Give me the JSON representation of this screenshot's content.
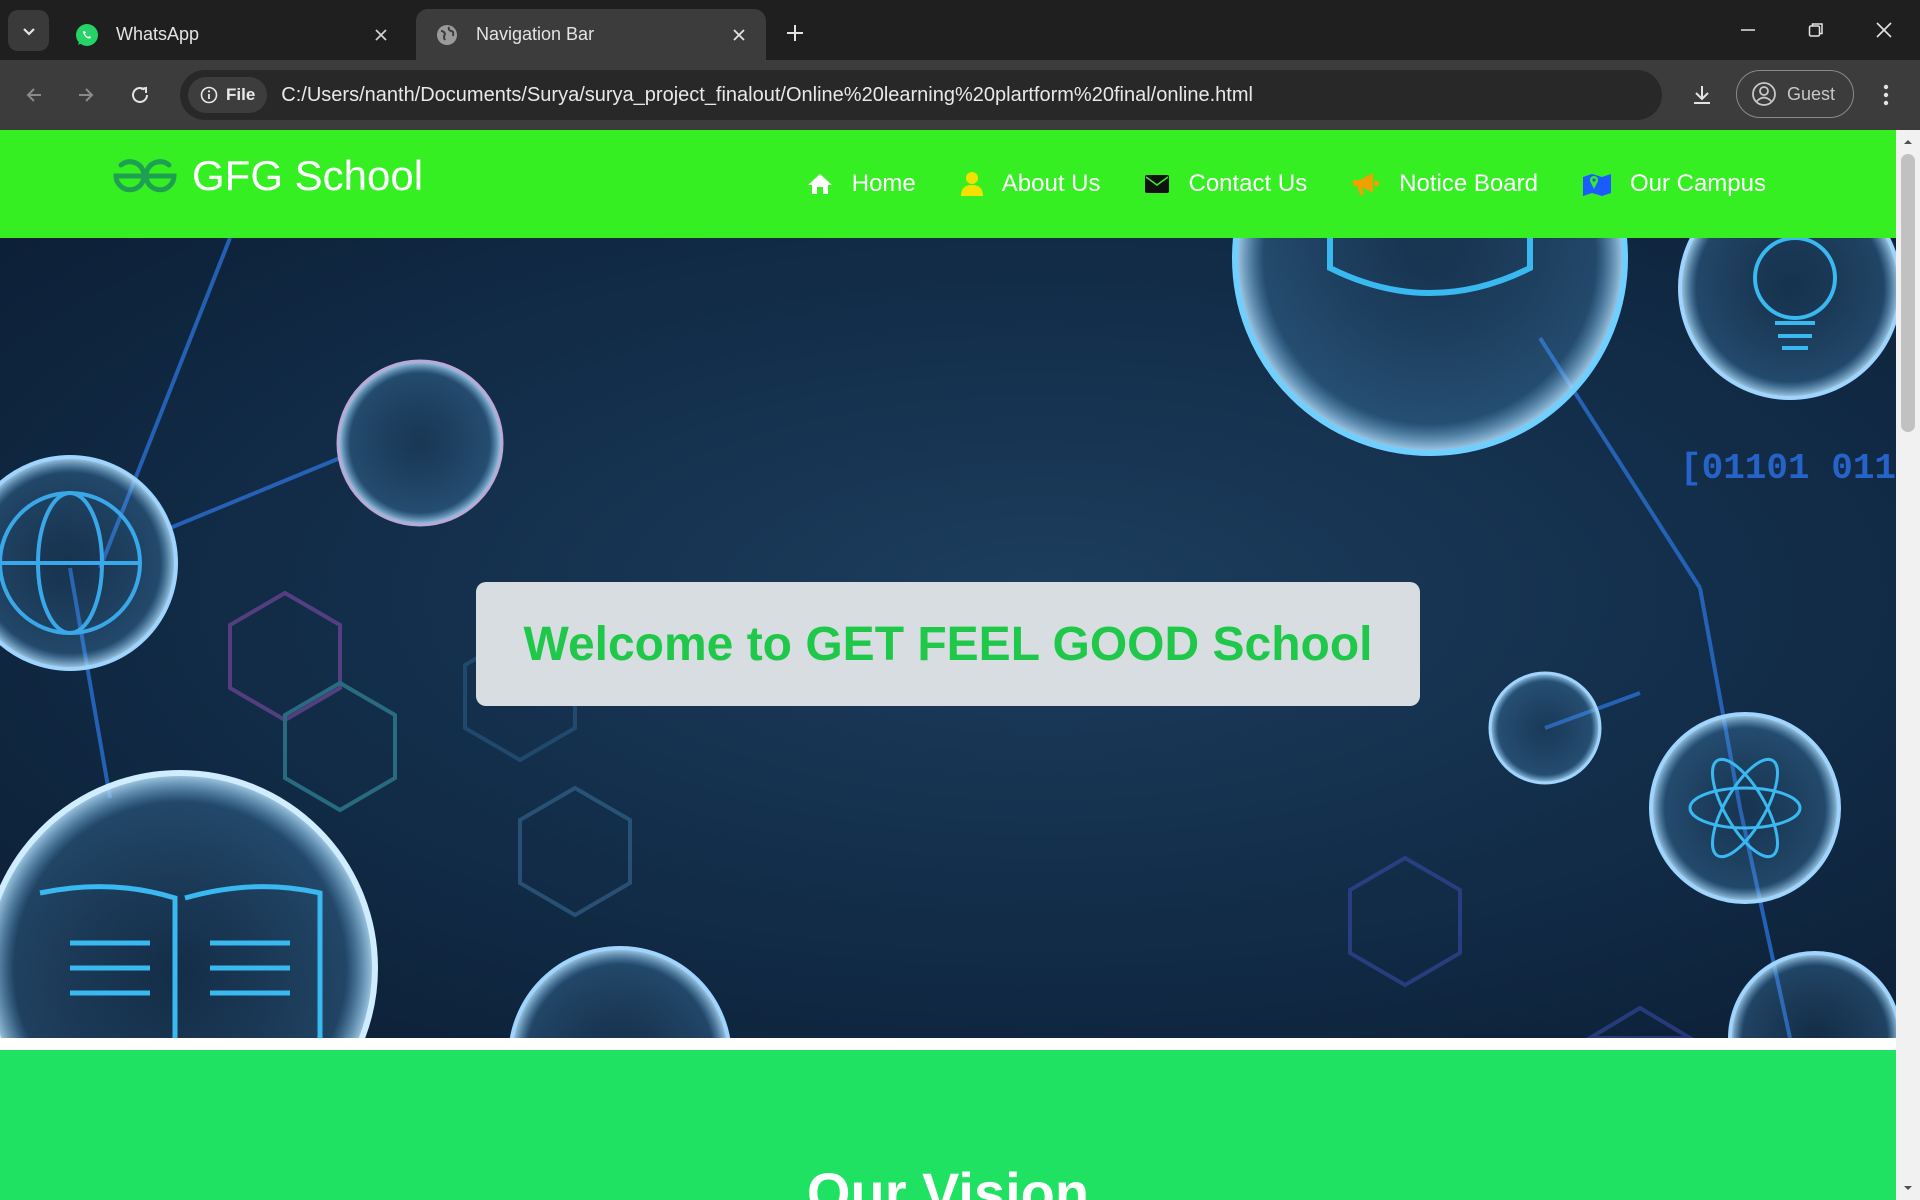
{
  "browser": {
    "tabs": [
      {
        "title": "WhatsApp",
        "favicon": "whatsapp-icon",
        "active": false
      },
      {
        "title": "Navigation Bar",
        "favicon": "globe-icon",
        "active": true
      }
    ],
    "address_chip": "File",
    "url": "C:/Users/nanth/Documents/Surya/surya_project_finalout/Online%20learning%20plartform%20final/online.html",
    "profile_label": "Guest"
  },
  "site": {
    "brand": "GFG School",
    "nav_items": [
      {
        "label": "Home",
        "icon": "home-icon",
        "icon_color": "#ffffff"
      },
      {
        "label": "About Us",
        "icon": "user-icon",
        "icon_color": "#f5e100"
      },
      {
        "label": "Contact Us",
        "icon": "envelope-icon",
        "icon_color": "#111111"
      },
      {
        "label": "Notice Board",
        "icon": "megaphone-icon",
        "icon_color": "#f0a000"
      },
      {
        "label": "Our Campus",
        "icon": "map-icon",
        "icon_color": "#1a5cff"
      }
    ],
    "hero_heading": "Welcome to GET FEEL GOOD School",
    "section_title": "Our Vision"
  },
  "colors": {
    "nav_bg": "#35ef23",
    "section_bg": "#1fe263",
    "heading_green": "#20c84a"
  }
}
